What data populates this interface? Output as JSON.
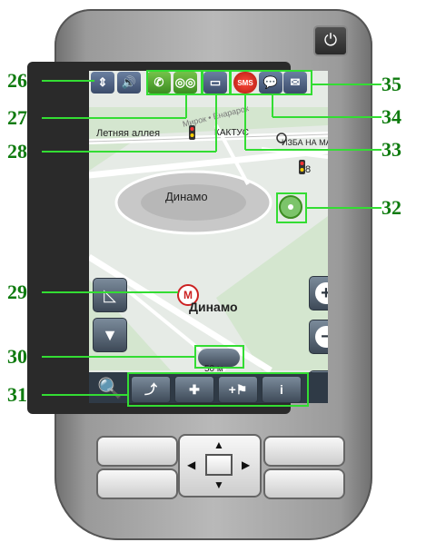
{
  "callouts": [
    "26",
    "27",
    "28",
    "29",
    "30",
    "31",
    "32",
    "33",
    "34",
    "35"
  ],
  "map": {
    "street_alley": "Летняя аллея",
    "street_mirok": "Мирок • Ёнарарок",
    "poi_cactus": "КАКТУС",
    "poi_izba": "ИЗБА НА МА",
    "poi_stadium": "Динамо",
    "metro_station": "Динамо",
    "metro_letter": "М",
    "distance_number": "8",
    "scale_label": "50 м"
  },
  "toolbar": {
    "sms_label": "SMS"
  },
  "colors": {
    "callout_green": "#33dd33",
    "number_green": "#0f7b0f",
    "screen_bg": "#e6ebe6"
  }
}
